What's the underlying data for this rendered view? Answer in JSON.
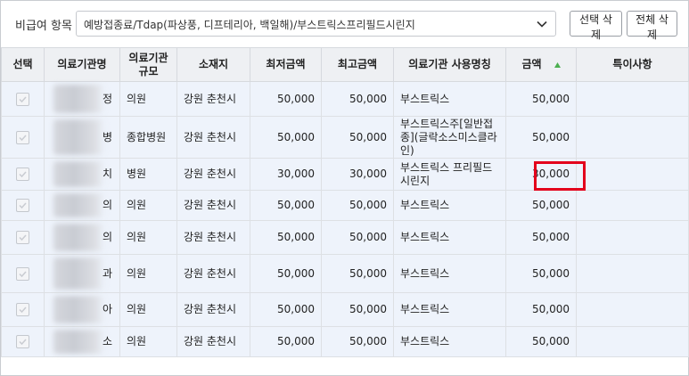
{
  "filter": {
    "label": "비급여 항목",
    "selected": "예방접종료/Tdap(파상풍, 디프테리아, 백일해)/부스트릭스프리필드시린지",
    "chevron_icon": "chevron-down-icon"
  },
  "buttons": {
    "delete_selected": "선택 삭제",
    "delete_all": "전체 삭제"
  },
  "table": {
    "headers": [
      "선택",
      "의료기관명",
      "의료기관 규모",
      "소재지",
      "최저금액",
      "최고금액",
      "의료기관 사용명칭",
      "금액",
      "특이사항"
    ],
    "sort_icon": "sort-up-icon",
    "rows": [
      {
        "name_tail": "정",
        "scale": "의원",
        "location": "강원 춘천시",
        "min": "50,000",
        "max": "50,000",
        "usage_name": "부스트릭스",
        "price": "50,000",
        "note": ""
      },
      {
        "name_tail": "병",
        "scale": "종합병원",
        "location": "강원 춘천시",
        "min": "50,000",
        "max": "50,000",
        "usage_name": "부스트릭스주[일반접종](글락소스미스클라인)",
        "price": "50,000",
        "note": ""
      },
      {
        "name_tail": "치",
        "scale": "병원",
        "location": "강원 춘천시",
        "min": "30,000",
        "max": "30,000",
        "usage_name": "부스트릭스 프리필드시린지",
        "price": "30,000",
        "note": ""
      },
      {
        "name_tail": "의",
        "scale": "의원",
        "location": "강원 춘천시",
        "min": "50,000",
        "max": "50,000",
        "usage_name": "부스트릭스",
        "price": "50,000",
        "note": ""
      },
      {
        "name_tail": "의",
        "scale": "의원",
        "location": "강원 춘천시",
        "min": "50,000",
        "max": "50,000",
        "usage_name": "부스트릭스",
        "price": "50,000",
        "note": ""
      },
      {
        "name_tail": "과",
        "scale": "의원",
        "location": "강원 춘천시",
        "min": "50,000",
        "max": "50,000",
        "usage_name": "부스트릭스",
        "price": "50,000",
        "note": ""
      },
      {
        "name_tail": "아",
        "scale": "의원",
        "location": "강원 춘천시",
        "min": "50,000",
        "max": "50,000",
        "usage_name": "부스트릭스",
        "price": "50,000",
        "note": ""
      },
      {
        "name_tail": "소",
        "scale": "의원",
        "location": "강원 춘천시",
        "min": "50,000",
        "max": "50,000",
        "usage_name": "부스트릭스",
        "price": "50,000",
        "note": ""
      }
    ]
  },
  "colors": {
    "highlight_border": "#e3001b",
    "row_background": "#eef3fb",
    "header_background": "#eef0f3",
    "sort_arrow": "#4caf50"
  }
}
